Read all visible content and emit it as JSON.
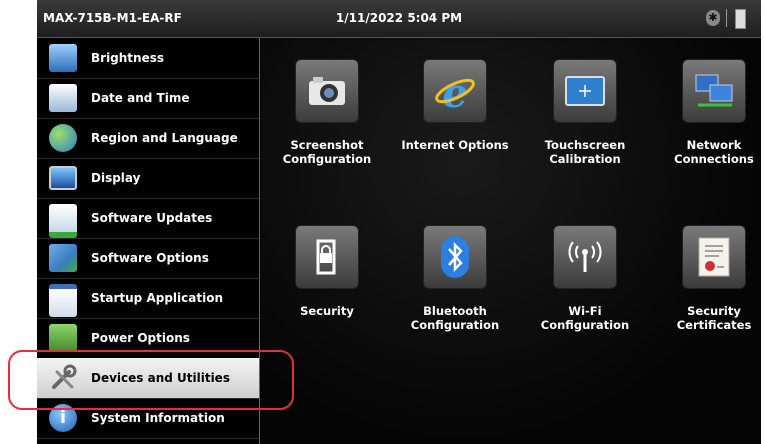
{
  "status_bar": {
    "device_name": "MAX-715B-M1-EA-RF",
    "datetime": "1/11/2022 5:04 PM"
  },
  "sidebar": {
    "items": [
      {
        "label": "Brightness",
        "icon": "monitor-brightness-icon",
        "selected": false
      },
      {
        "label": "Date and Time",
        "icon": "calendar-clock-icon",
        "selected": false
      },
      {
        "label": "Region and Language",
        "icon": "globe-icon",
        "selected": false
      },
      {
        "label": "Display",
        "icon": "display-icon",
        "selected": false
      },
      {
        "label": "Software Updates",
        "icon": "software-update-icon",
        "selected": false
      },
      {
        "label": "Software Options",
        "icon": "puzzle-plus-icon",
        "selected": false
      },
      {
        "label": "Startup Application",
        "icon": "startup-star-icon",
        "selected": false
      },
      {
        "label": "Power Options",
        "icon": "power-options-icon",
        "selected": false
      },
      {
        "label": "Devices and Utilities",
        "icon": "tools-icon",
        "selected": true
      },
      {
        "label": "System Information",
        "icon": "info-icon",
        "selected": false
      }
    ]
  },
  "tiles": [
    {
      "line1": "Screenshot",
      "line2": "Configuration",
      "icon": "camera-icon"
    },
    {
      "line1": "Internet Options",
      "line2": "",
      "icon": "internet-explorer-icon"
    },
    {
      "line1": "Touchscreen",
      "line2": "Calibration",
      "icon": "touchscreen-calibration-icon"
    },
    {
      "line1": "Network",
      "line2": "Connections",
      "icon": "network-computers-icon"
    },
    {
      "line1": "Security",
      "line2": "",
      "icon": "phone-lock-icon"
    },
    {
      "line1": "Bluetooth",
      "line2": "Configuration",
      "icon": "bluetooth-icon"
    },
    {
      "line1": "Wi-Fi",
      "line2": "Configuration",
      "icon": "wifi-antenna-icon"
    },
    {
      "line1": "Security",
      "line2": "Certificates",
      "icon": "certificate-icon"
    }
  ],
  "colors": {
    "highlight": "#e0303a",
    "background": "#050505"
  }
}
